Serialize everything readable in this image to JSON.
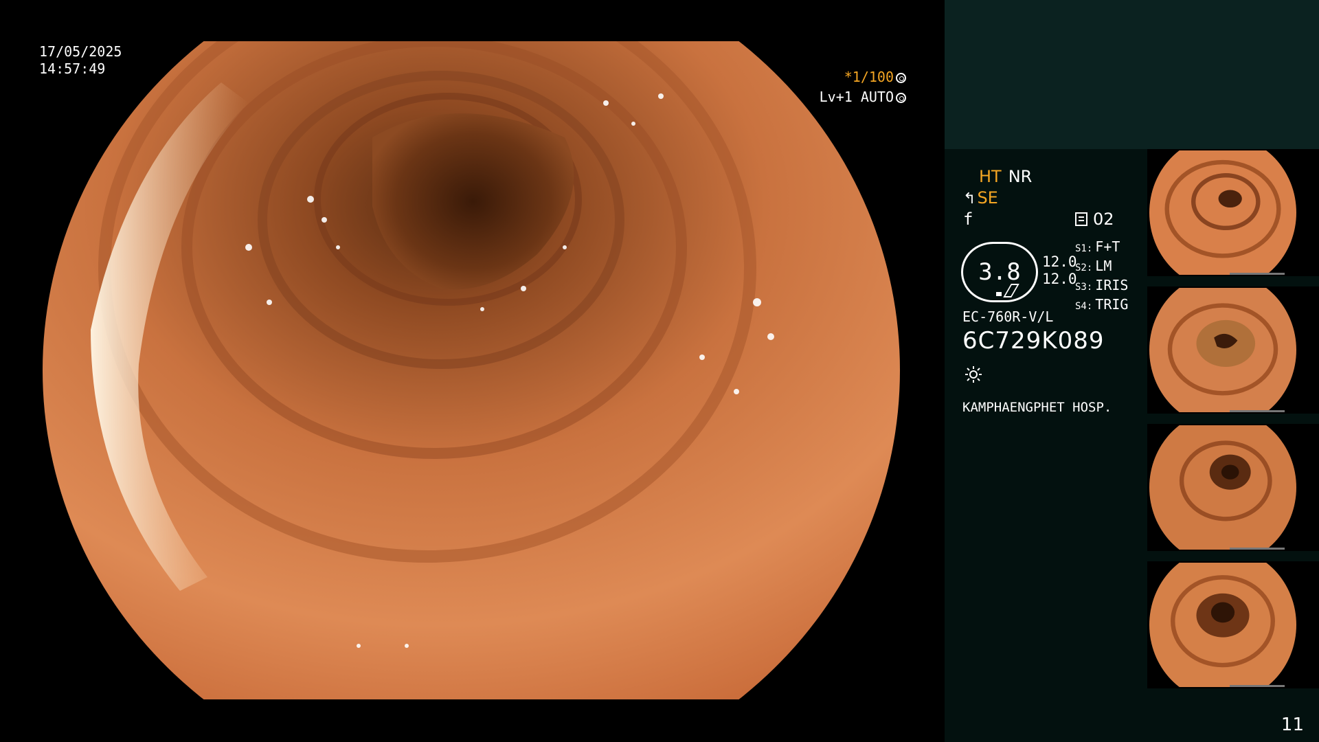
{
  "overlay": {
    "date": "17/05/2025",
    "time": "14:57:49",
    "shutter": "*1/100",
    "level": "Lv+1 AUTO"
  },
  "panel": {
    "mode_ht": "HT",
    "mode_nr": "NR",
    "se": "SE",
    "f_symbol": "f",
    "memo_count": "02",
    "badge_value": "3.8",
    "values": [
      "12.0",
      "12.0"
    ],
    "switches": [
      {
        "key": "S1:",
        "value": "F+T"
      },
      {
        "key": "S2:",
        "value": "LM"
      },
      {
        "key": "S3:",
        "value": "IRIS"
      },
      {
        "key": "S4:",
        "value": "TRIG"
      }
    ],
    "scope_model": "EC-760R-V/L",
    "serial": "6C729K089",
    "hospital": "KAMPHAENGPHET HOSP."
  },
  "page_number": "11",
  "thumbnails": [
    {
      "label": "thumbnail-1"
    },
    {
      "label": "thumbnail-2"
    },
    {
      "label": "thumbnail-3"
    },
    {
      "label": "thumbnail-4"
    }
  ],
  "colors": {
    "accent_orange": "#f5a623",
    "panel_bg": "#03110f",
    "panel_top": "#0b2220",
    "tissue": "#d9804a"
  }
}
